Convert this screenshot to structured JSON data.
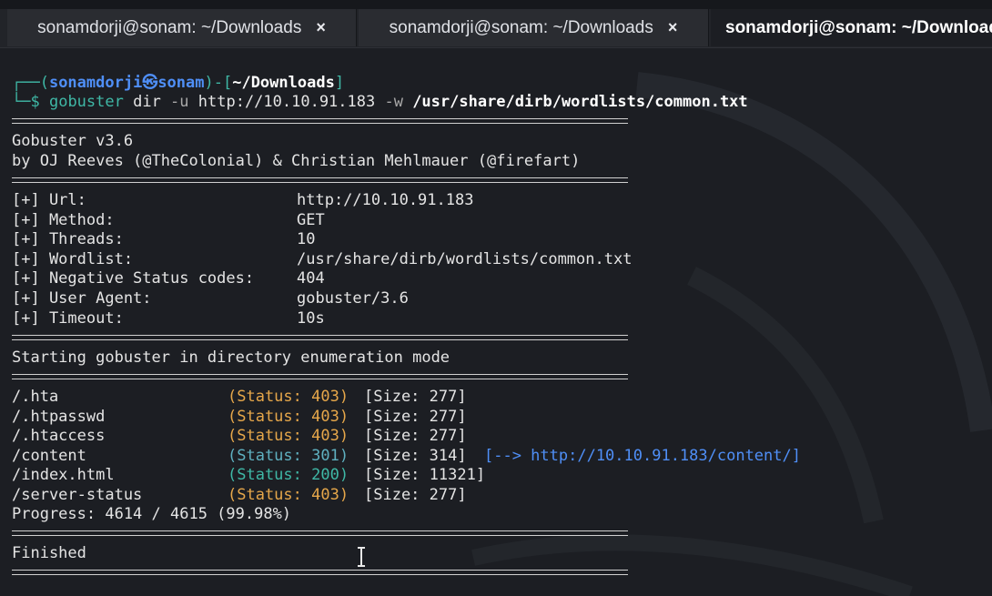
{
  "tabs": [
    {
      "label": "sonamdorji@sonam: ~/Downloads",
      "close": "×"
    },
    {
      "label": "sonamdorji@sonam: ~/Downloads",
      "close": "×"
    },
    {
      "label": "sonamdorji@sonam: ~/Downloads",
      "close": ""
    }
  ],
  "prompt": {
    "open": "┌──(",
    "user": "sonamdorji",
    "at": "㉿",
    "host": "sonam",
    "mid": ")-[",
    "path": "~/Downloads",
    "close": "]",
    "sym": "└─$",
    "cmd": "gobuster",
    "args1": " dir ",
    "flag_u": "-u",
    "url": " http://10.10.91.183 ",
    "flag_w": "-w",
    "wordlist": " /usr/share/dirb/wordlists/common.txt"
  },
  "banner": {
    "version": "Gobuster v3.6",
    "authors": "by OJ Reeves (@TheColonial) & Christian Mehlmauer (@firefart)"
  },
  "config": [
    {
      "key": "[+] Url:",
      "value": "http://10.10.91.183"
    },
    {
      "key": "[+] Method:",
      "value": "GET"
    },
    {
      "key": "[+] Threads:",
      "value": "10"
    },
    {
      "key": "[+] Wordlist:",
      "value": "/usr/share/dirb/wordlists/common.txt"
    },
    {
      "key": "[+] Negative Status codes:",
      "value": "404"
    },
    {
      "key": "[+] User Agent:",
      "value": "gobuster/3.6"
    },
    {
      "key": "[+] Timeout:",
      "value": "10s"
    }
  ],
  "start_msg": "Starting gobuster in directory enumeration mode",
  "results": [
    {
      "path": "/.hta",
      "status": "(Status: 403)",
      "size": "[Size: 277]",
      "redirect": ""
    },
    {
      "path": "/.htpasswd",
      "status": "(Status: 403)",
      "size": "[Size: 277]",
      "redirect": ""
    },
    {
      "path": "/.htaccess",
      "status": "(Status: 403)",
      "size": "[Size: 277]",
      "redirect": ""
    },
    {
      "path": "/content",
      "status": "(Status: 301)",
      "size": "[Size: 314]",
      "redirect": "[--> http://10.10.91.183/content/]"
    },
    {
      "path": "/index.html",
      "status": "(Status: 200)",
      "size": "[Size: 11321]",
      "redirect": ""
    },
    {
      "path": "/server-status",
      "status": "(Status: 403)",
      "size": "[Size: 277]",
      "redirect": ""
    }
  ],
  "progress": "Progress: 4614 / 4615 (99.98%)",
  "finished": "Finished",
  "colors": {
    "status_403": "#e6a74a",
    "status_301": "#5fb0c0",
    "status_200": "#3fb8a6",
    "prompt_blue": "#4f8ff7"
  }
}
